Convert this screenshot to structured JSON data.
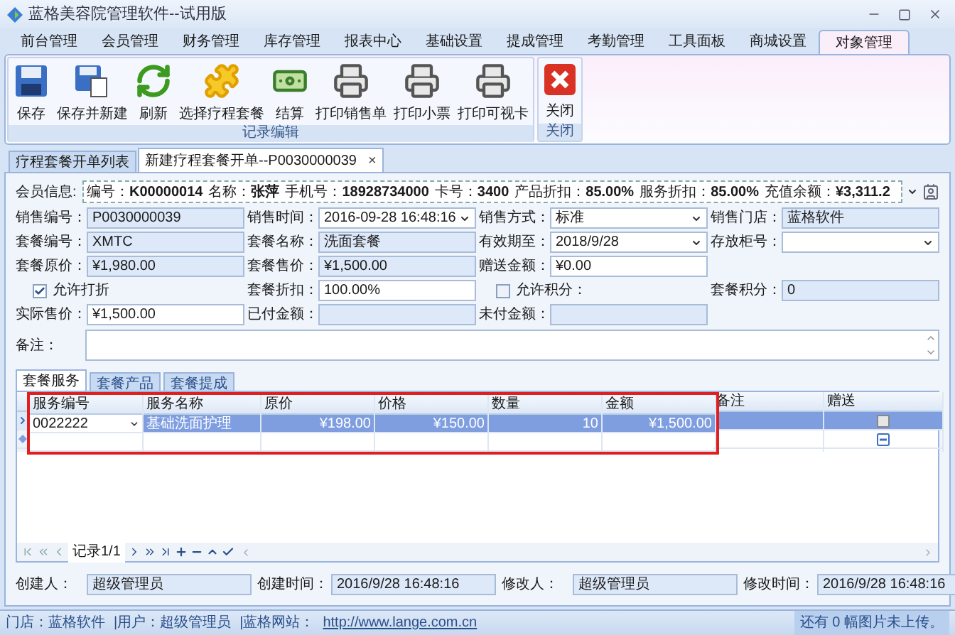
{
  "window": {
    "title": "蓝格美容院管理软件--试用版"
  },
  "menu_tabs": [
    {
      "label": "前台管理",
      "selected": false
    },
    {
      "label": "会员管理",
      "selected": false
    },
    {
      "label": "财务管理",
      "selected": false
    },
    {
      "label": "库存管理",
      "selected": false
    },
    {
      "label": "报表中心",
      "selected": false
    },
    {
      "label": "基础设置",
      "selected": false
    },
    {
      "label": "提成管理",
      "selected": false
    },
    {
      "label": "考勤管理",
      "selected": false
    },
    {
      "label": "工具面板",
      "selected": false
    },
    {
      "label": "商城设置",
      "selected": false
    },
    {
      "label": "对象管理",
      "selected": true
    }
  ],
  "ribbon": [
    {
      "label": "记录编辑",
      "buttons": [
        {
          "label": "保存",
          "kind": "save"
        },
        {
          "label": "保存并新建",
          "kind": "save_new"
        },
        {
          "label": "刷新",
          "kind": "refresh"
        },
        {
          "label": "选择疗程套餐",
          "kind": "package"
        },
        {
          "label": "结算",
          "kind": "settle"
        },
        {
          "label": "打印销售单",
          "kind": "print"
        },
        {
          "label": "打印小票",
          "kind": "print"
        },
        {
          "label": "打印可视卡",
          "kind": "print"
        }
      ]
    },
    {
      "label": "关闭",
      "buttons": [
        {
          "label": "关闭",
          "kind": "close"
        }
      ]
    }
  ],
  "doc_tabs": [
    {
      "label": "疗程套餐开单列表",
      "selected": false
    },
    {
      "label": "新建疗程套餐开单--P0030000039",
      "selected": true,
      "close": "×"
    }
  ],
  "member": {
    "label": "会员信息:",
    "items": [
      {
        "label": "编号：",
        "value": "K00000014"
      },
      {
        "label": "名称：",
        "value": "张萍"
      },
      {
        "label": "手机号：",
        "value": "18928734000"
      },
      {
        "label": "卡号：",
        "value": "3400"
      },
      {
        "label": "产品折扣：",
        "value": "85.00%"
      },
      {
        "label": "服务折扣：",
        "value": "85.00%"
      },
      {
        "label": "充值余额：",
        "value": "¥3,311.2"
      }
    ]
  },
  "form_rows": [
    [
      {
        "kind": "text",
        "label": "销售编号：",
        "value": "P0030000039",
        "readonly": true
      },
      {
        "kind": "combo",
        "label": "销售时间：",
        "value": "2016-09-28 16:48:16",
        "readonly": false
      },
      {
        "kind": "combo",
        "label": "销售方式：",
        "value": "标准",
        "readonly": false
      },
      {
        "kind": "text",
        "label": "销售门店：",
        "value": "蓝格软件",
        "readonly": true
      }
    ],
    [
      {
        "kind": "text",
        "label": "套餐编号：",
        "value": "XMTC",
        "readonly": true
      },
      {
        "kind": "text",
        "label": "套餐名称：",
        "value": "洗面套餐",
        "readonly": true
      },
      {
        "kind": "combo",
        "label": "有效期至：",
        "value": "2018/9/28",
        "readonly": false
      },
      {
        "kind": "combo",
        "label": "存放柜号：",
        "readonly": false
      }
    ],
    [
      {
        "kind": "text",
        "label": "套餐原价：",
        "value": "¥1,980.00",
        "readonly": true
      },
      {
        "kind": "text",
        "label": "套餐售价：",
        "value": "¥1,500.00",
        "readonly": true
      },
      {
        "kind": "text",
        "label": "赠送金额：",
        "value": "¥0.00",
        "readonly": false
      }
    ],
    [
      {
        "kind": "checkbox",
        "label": "允许打折",
        "checked": true
      },
      {
        "kind": "text",
        "label": "套餐折扣：",
        "value": "100.00%",
        "readonly": false
      },
      {
        "kind": "checkbox",
        "label": "允许积分：",
        "checked": false
      },
      {
        "kind": "text",
        "label": "套餐积分：",
        "value": "0",
        "readonly": true
      }
    ],
    [
      {
        "kind": "text",
        "label": "实际售价：",
        "value": "¥1,500.00",
        "readonly": false
      },
      {
        "kind": "text",
        "label": "已付金额：",
        "readonly": true
      },
      {
        "kind": "text",
        "label": "未付金额：",
        "readonly": true
      }
    ]
  ],
  "note": {
    "label": "备注："
  },
  "detail_tabs": [
    {
      "label": "套餐服务",
      "selected": true
    },
    {
      "label": "套餐产品",
      "selected": false
    },
    {
      "label": "套餐提成",
      "selected": false
    }
  ],
  "grid": {
    "columns": [
      {
        "label": "服务编号",
        "highlighted": true
      },
      {
        "label": "服务名称",
        "highlighted": true
      },
      {
        "label": "原价",
        "highlighted": true
      },
      {
        "label": "价格",
        "highlighted": true
      },
      {
        "label": "数量",
        "highlighted": true
      },
      {
        "label": "金额",
        "highlighted": true
      },
      {
        "label": "备注",
        "highlighted": false
      },
      {
        "label": "赠送",
        "highlighted": false,
        "kind": "checkbox"
      }
    ],
    "rows": [
      {
        "selected": true,
        "cells": [
          "0022222",
          "基础洗面护理",
          "¥198.00",
          "¥150.00",
          "10",
          "¥1,500.00"
        ],
        "gift": false
      }
    ],
    "navigator": "记录1/1"
  },
  "footer": [
    {
      "label": "创建人：",
      "value": "超级管理员"
    },
    {
      "label": "创建时间：",
      "value": "2016/9/28 16:48:16"
    },
    {
      "label": "修改人：",
      "value": "超级管理员"
    },
    {
      "label": "修改时间：",
      "value": "2016/9/28 16:48:16"
    }
  ],
  "status_bar": {
    "items": [
      "门店：蓝格软件",
      "|用户：超级管理员",
      "|蓝格网站："
    ],
    "link": "http://www.lange.com.cn",
    "right": "还有 0 幅图片未上传。"
  }
}
